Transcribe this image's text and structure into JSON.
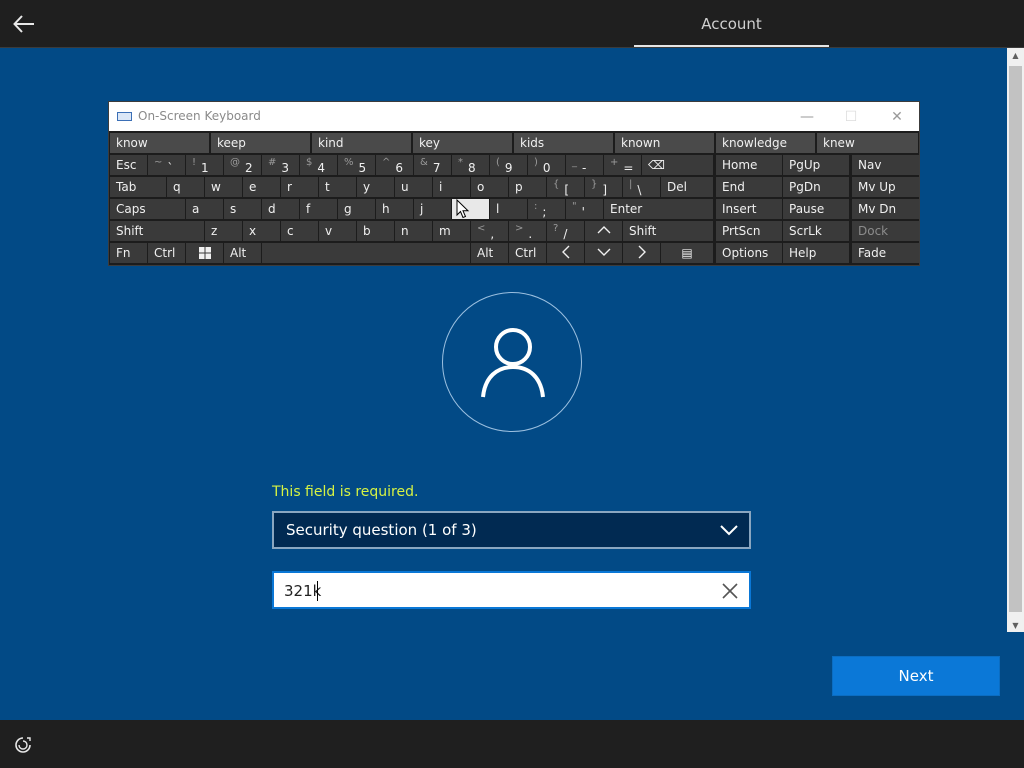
{
  "header": {
    "tab_label": "Account"
  },
  "osk": {
    "title": "On-Screen Keyboard",
    "window_controls": {
      "minimize": "—",
      "maximize": "☐",
      "close": "✕"
    },
    "suggestions": [
      "know",
      "keep",
      "kind",
      "key",
      "kids",
      "known",
      "knowledge",
      "knew"
    ],
    "keys": {
      "esc": "Esc",
      "tilde_sup": "~",
      "tilde": "`",
      "n1_sup": "!",
      "n1": "1",
      "n2_sup": "@",
      "n2": "2",
      "n3_sup": "#",
      "n3": "3",
      "n4_sup": "$",
      "n4": "4",
      "n5_sup": "%",
      "n5": "5",
      "n6_sup": "^",
      "n6": "6",
      "n7_sup": "&",
      "n7": "7",
      "n8_sup": "*",
      "n8": "8",
      "n9_sup": "(",
      "n9": "9",
      "n0_sup": ")",
      "n0": "0",
      "minus_sup": "_",
      "minus": "-",
      "plus_sup": "+",
      "plus": "=",
      "backspace": "⌫",
      "tab": "Tab",
      "q": "q",
      "w": "w",
      "e": "e",
      "r": "r",
      "t": "t",
      "y": "y",
      "u": "u",
      "i": "i",
      "o": "o",
      "p": "p",
      "lbrace_sup": "{",
      "lbrace": "[",
      "rbrace_sup": "}",
      "rbrace": "]",
      "pipe_sup": "|",
      "pipe": "\\",
      "del": "Del",
      "caps": "Caps",
      "a": "a",
      "s": "s",
      "d": "d",
      "f": "f",
      "g": "g",
      "h": "h",
      "j": "j",
      "k": "",
      "l": "l",
      "colon_sup": ":",
      "colon": ";",
      "quote_sup": "\"",
      "quote": "'",
      "enter": "Enter",
      "shift": "Shift",
      "z": "z",
      "x": "x",
      "c": "c",
      "v": "v",
      "b": "b",
      "n": "n",
      "m": "m",
      "lt_sup": "<",
      "lt": ",",
      "gt_sup": ">",
      "gt": ".",
      "q_sup": "?",
      "slash": "/",
      "up": "^",
      "shift_r": "Shift",
      "fn": "Fn",
      "ctrl": "Ctrl",
      "alt": "Alt",
      "alt_r": "Alt",
      "ctrl_r": "Ctrl",
      "left": "<",
      "down": "v",
      "right": ">",
      "menu": "▤",
      "home": "Home",
      "pgup": "PgUp",
      "nav": "Nav",
      "end": "End",
      "pgdn": "PgDn",
      "mvup": "Mv Up",
      "insert": "Insert",
      "pause": "Pause",
      "mvdn": "Mv Dn",
      "prtscn": "PrtScn",
      "scrlk": "ScrLk",
      "dock": "Dock",
      "options": "Options",
      "help": "Help",
      "fade": "Fade"
    }
  },
  "form": {
    "error": "This field is required.",
    "security_question": "Security question (1 of 3)",
    "answer_value": "321k",
    "next_label": "Next"
  },
  "colors": {
    "background": "#024a86",
    "accent": "#0b78d7",
    "error": "#d6f243"
  }
}
